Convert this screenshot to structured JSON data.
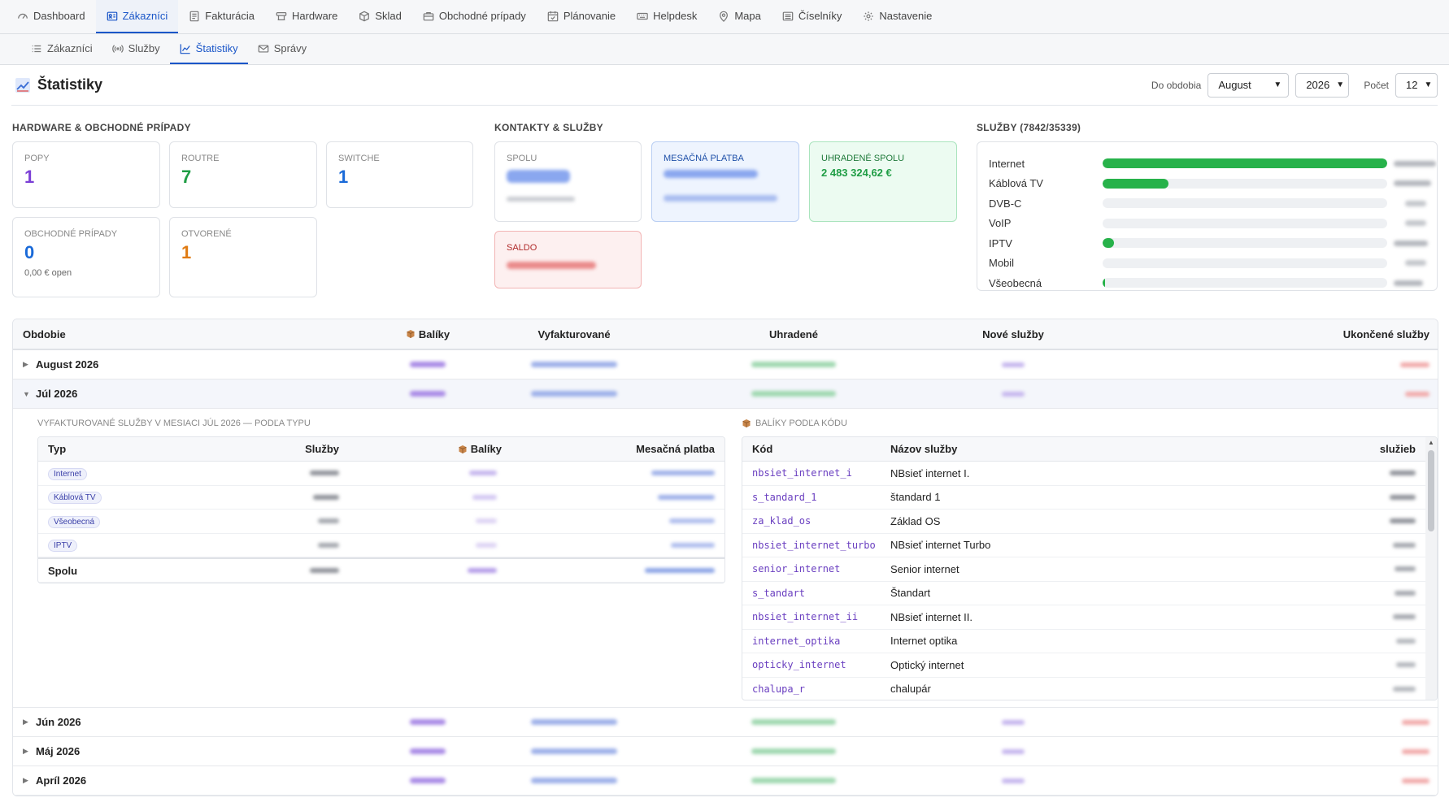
{
  "nav": {
    "items": [
      {
        "label": "Dashboard",
        "icon": "dashboard-icon",
        "active": false
      },
      {
        "label": "Zákazníci",
        "icon": "customers-icon",
        "active": true
      },
      {
        "label": "Fakturácia",
        "icon": "invoice-icon",
        "active": false
      },
      {
        "label": "Hardware",
        "icon": "hardware-icon",
        "active": false
      },
      {
        "label": "Sklad",
        "icon": "box-icon",
        "active": false
      },
      {
        "label": "Obchodné prípady",
        "icon": "briefcase-icon",
        "active": false
      },
      {
        "label": "Plánovanie",
        "icon": "calendar-icon",
        "active": false
      },
      {
        "label": "Helpdesk",
        "icon": "keyboard-icon",
        "active": false
      },
      {
        "label": "Mapa",
        "icon": "map-pin-icon",
        "active": false
      },
      {
        "label": "Číselníky",
        "icon": "list-icon",
        "active": false
      },
      {
        "label": "Nastavenie",
        "icon": "gear-icon",
        "active": false
      }
    ]
  },
  "subnav": {
    "items": [
      {
        "label": "Zákazníci",
        "icon": "list-icon",
        "active": false
      },
      {
        "label": "Služby",
        "icon": "signal-icon",
        "active": false
      },
      {
        "label": "Štatistiky",
        "icon": "chart-line-icon",
        "active": true
      },
      {
        "label": "Správy",
        "icon": "mail-icon",
        "active": false
      }
    ]
  },
  "header": {
    "title": "Štatistiky",
    "period_label": "Do obdobia",
    "month": "August",
    "year": "2026",
    "count_label": "Počet",
    "count": "12"
  },
  "hw": {
    "title": "HARDWARE & OBCHODNÉ PRÍPADY",
    "popy_label": "POPY",
    "popy_value": "1",
    "routre_label": "ROUTRE",
    "routre_value": "7",
    "switche_label": "SWITCHE",
    "switche_value": "1",
    "op_label": "OBCHODNÉ PRÍPADY",
    "op_value": "0",
    "op_sub": "0,00 € open",
    "otv_label": "OTVORENÉ",
    "otv_value": "1"
  },
  "contacts": {
    "title": "KONTAKTY & SLUŽBY",
    "spolu_label": "SPOLU",
    "mesacna_label": "MESAČNÁ PLATBA",
    "uhradene_label": "UHRADENÉ SPOLU",
    "uhradene_value": "2 483 324,62 €",
    "saldo_label": "SALDO"
  },
  "services": {
    "title": "SLUŽBY (7842/35339)",
    "items": [
      {
        "name": "Internet",
        "share": 1.0
      },
      {
        "name": "Káblová TV",
        "share": 0.23
      },
      {
        "name": "DVB-C",
        "share": 0
      },
      {
        "name": "VoIP",
        "share": 0
      },
      {
        "name": "IPTV",
        "share": 0.04
      },
      {
        "name": "Mobil",
        "share": 0
      },
      {
        "name": "Všeobecná",
        "share": 0.008
      }
    ]
  },
  "table": {
    "headers": {
      "period": "Obdobie",
      "balicky": "Balíky",
      "vyfakturovane": "Vyfakturované",
      "uhradene": "Uhradené",
      "nove": "Nové služby",
      "ukoncene": "Ukončené služby"
    },
    "rows_top": [
      "August 2026",
      "Júl 2026"
    ],
    "rows_bottom": [
      "Jún 2026",
      "Máj 2026",
      "Apríl 2026"
    ]
  },
  "expanded": {
    "left_title": "VYFAKTUROVANÉ SLUŽBY V MESIACI JÚL 2026 — PODĽA TYPU",
    "left_headers": {
      "typ": "Typ",
      "sluzby": "Služby",
      "balicky": "Balíky",
      "mesacna": "Mesačná platba"
    },
    "types": [
      "Internet",
      "Káblová TV",
      "Všeobecná",
      "IPTV"
    ],
    "total_label": "Spolu",
    "right_title": "BALÍKY PODĽA KÓDU",
    "right_headers": {
      "kod": "Kód",
      "nazov": "Názov služby",
      "sluzieb": "služieb"
    },
    "codes": [
      {
        "kod": "nbsiet_internet_i",
        "nazov": "NBsieť internet I."
      },
      {
        "kod": "s_tandard_1",
        "nazov": "štandard 1"
      },
      {
        "kod": "za_klad_os",
        "nazov": "Základ OS"
      },
      {
        "kod": "nbsiet_internet_turbo",
        "nazov": "NBsieť internet Turbo"
      },
      {
        "kod": "senior_internet",
        "nazov": "Senior internet"
      },
      {
        "kod": "s_tandart",
        "nazov": "Štandart"
      },
      {
        "kod": "nbsiet_internet_ii",
        "nazov": "NBsieť internet II."
      },
      {
        "kod": "internet_optika",
        "nazov": "Internet optika"
      },
      {
        "kod": "opticky_internet",
        "nazov": "Optický internet"
      },
      {
        "kod": "chalupa_r",
        "nazov": "chalupár"
      }
    ]
  },
  "colors": {
    "accent": "#1a56c8",
    "purple": "#7b3fd6",
    "green": "#1f9d45",
    "blue": "#1a6ad8",
    "orange": "#e07b12",
    "bar": "#27b24a"
  }
}
